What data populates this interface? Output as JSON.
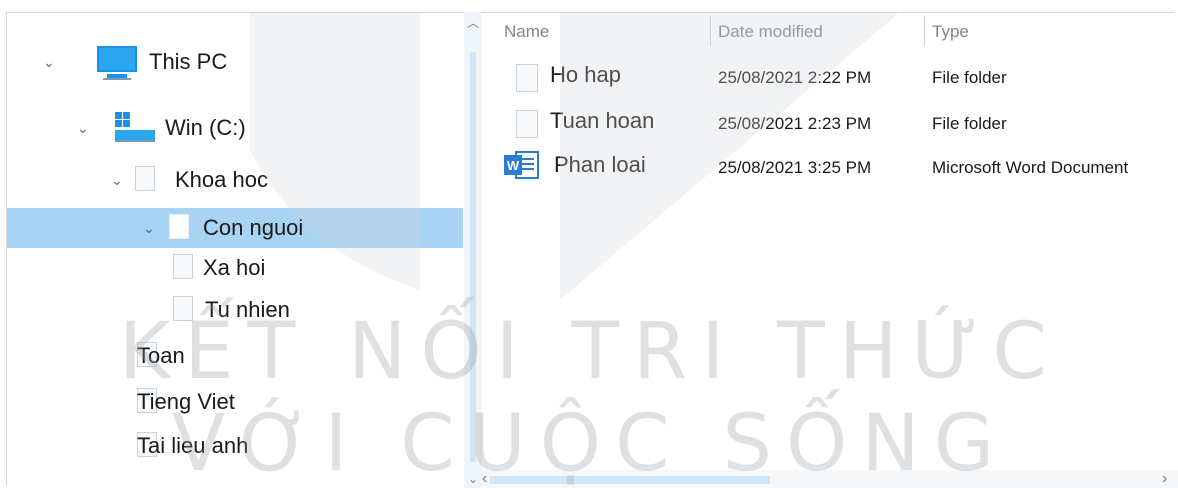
{
  "tree": {
    "items": [
      {
        "label": "This PC",
        "icon": "monitor-icon",
        "expanded": true
      },
      {
        "label": "Win (C:)",
        "icon": "windows-drive-icon",
        "expanded": true
      },
      {
        "label": "Khoa hoc",
        "icon": "folder-icon",
        "expanded": true
      },
      {
        "label": "Con nguoi",
        "icon": "folder-icon",
        "expanded": true,
        "selected": true
      },
      {
        "label": "Xa hoi",
        "icon": "folder-icon"
      },
      {
        "label": "Tu nhien",
        "icon": "folder-icon"
      },
      {
        "label": "Toan",
        "icon": "folder-icon"
      },
      {
        "label": "Tieng Viet",
        "icon": "folder-icon"
      },
      {
        "label": "Tai lieu anh",
        "icon": "folder-icon"
      }
    ]
  },
  "list": {
    "columns": [
      "Name",
      "Date modified",
      "Type"
    ],
    "files": [
      {
        "name": "Ho hap",
        "date": "25/08/2021 2:22 PM",
        "type": "File folder",
        "icon": "folder-icon"
      },
      {
        "name": "Tuan hoan",
        "date": "25/08/2021 2:23 PM",
        "type": "File folder",
        "icon": "folder-icon"
      },
      {
        "name": "Phan loai",
        "date": "25/08/2021 3:25 PM",
        "type": "Microsoft Word Document",
        "icon": "word-document-icon"
      }
    ]
  },
  "watermark": {
    "line1": "KẾT NỐI TRI THỨC",
    "line2": "VỚI CUỘC SỐNG"
  },
  "colors": {
    "selection": "#a9d3f3",
    "word_blue": "#2b7cd3",
    "monitor_blue": "#1e90e6"
  }
}
